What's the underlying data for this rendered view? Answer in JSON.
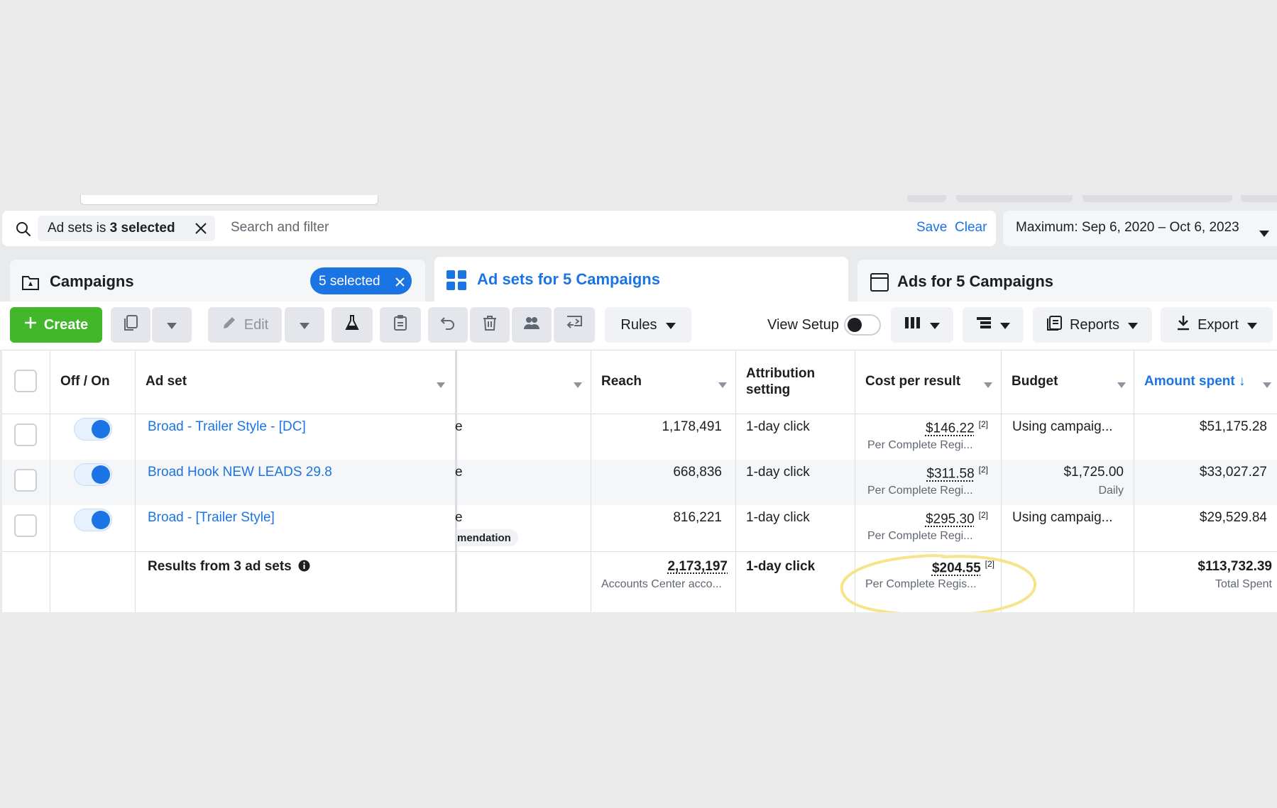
{
  "filter_bar": {
    "chip_prefix": "Ad sets is ",
    "chip_bold": "3 selected",
    "search_placeholder": "Search and filter",
    "save_label": "Save",
    "clear_label": "Clear",
    "date_range": "Maximum: Sep 6, 2020 – Oct 6, 2023"
  },
  "tabs": [
    {
      "label": "Campaigns",
      "selected_count": "5 selected"
    },
    {
      "label": "Ad sets for 5 Campaigns"
    },
    {
      "label": "Ads for 5 Campaigns"
    }
  ],
  "toolbar": {
    "create_label": "Create",
    "edit_label": "Edit",
    "rules_label": "Rules",
    "view_setup_label": "View Setup",
    "reports_label": "Reports",
    "export_label": "Export"
  },
  "columns": {
    "off_on": "Off / On",
    "ad_set": "Ad set",
    "reach": "Reach",
    "attribution_line1": "Attribution",
    "attribution_line2": "setting",
    "cost_per_result": "Cost per result",
    "budget": "Budget",
    "amount_spent": "Amount spent ↓"
  },
  "rows": [
    {
      "name": "Broad - Trailer Style - [DC]",
      "reach": "1,178,491",
      "attribution": "1-day click",
      "cost": "$146.22",
      "cost_sup": "[2]",
      "cost_sub": "Per Complete Regi...",
      "budget": "Using campaig...",
      "budget_sub": "",
      "spent": "$51,175.28",
      "hidden_col": "e",
      "hidden_sub": ""
    },
    {
      "name": "Broad Hook NEW LEADS 29.8",
      "reach": "668,836",
      "attribution": "1-day click",
      "cost": "$311.58",
      "cost_sup": "[2]",
      "cost_sub": "Per Complete Regi...",
      "budget": "$1,725.00",
      "budget_sub": "Daily",
      "spent": "$33,027.27",
      "hidden_col": "e",
      "hidden_sub": ""
    },
    {
      "name": "Broad - [Trailer Style]",
      "reach": "816,221",
      "attribution": "1-day click",
      "cost": "$295.30",
      "cost_sup": "[2]",
      "cost_sub": "Per Complete Regi...",
      "budget": "Using campaig...",
      "budget_sub": "",
      "spent": "$29,529.84",
      "hidden_col": "e",
      "hidden_sub": "mendation"
    }
  ],
  "totals": {
    "label": "Results from 3 ad sets",
    "reach": "2,173,197",
    "reach_sub": "Accounts Center acco...",
    "attribution": "1-day click",
    "cost": "$204.55",
    "cost_sup": "[2]",
    "cost_sub": "Per Complete Regis...",
    "spent": "$113,732.39",
    "spent_sub": "Total Spent"
  },
  "colors": {
    "accent": "#1b74e4",
    "create_green": "#42b72a",
    "highlight": "#f7e38a"
  }
}
